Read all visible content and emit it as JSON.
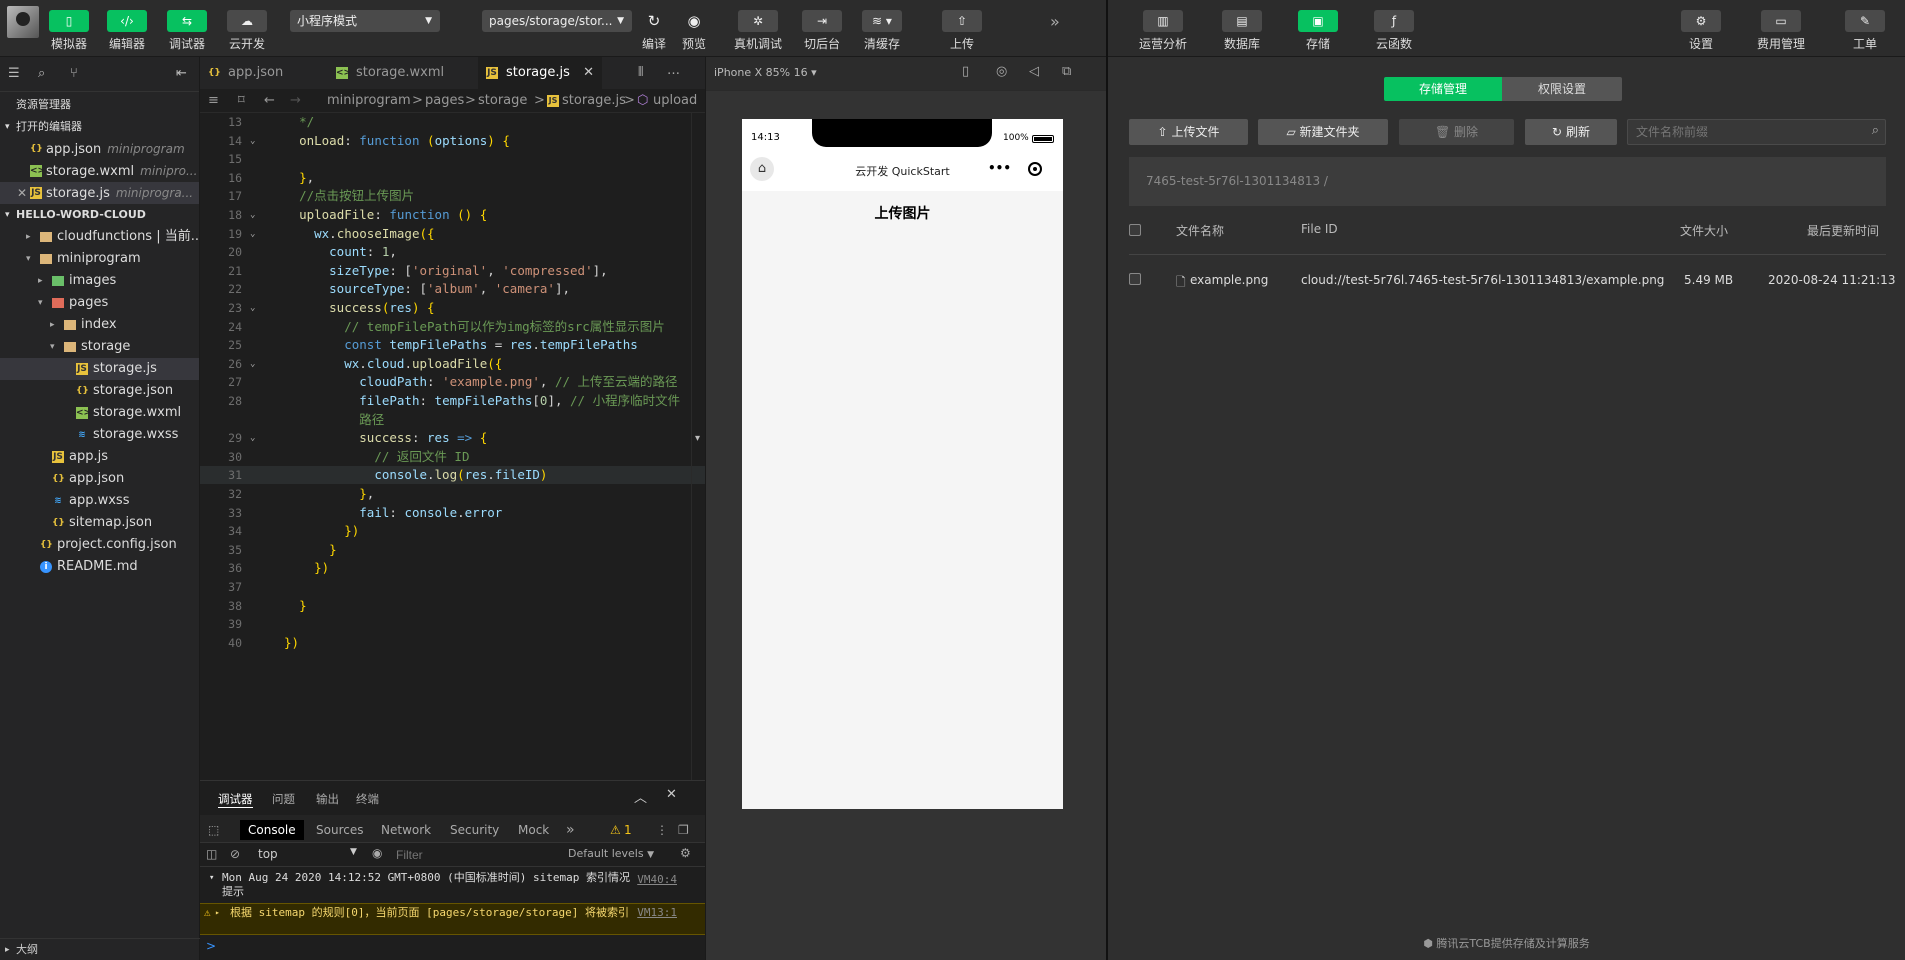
{
  "toolbar": {
    "buttons": [
      {
        "icon": "phone-icon",
        "label": "模拟器"
      },
      {
        "icon": "code-icon",
        "label": "编辑器"
      },
      {
        "icon": "debug-icon",
        "label": "调试器"
      },
      {
        "icon": "cloud-icon",
        "label": "云开发"
      }
    ],
    "mode_select": "小程序模式",
    "page_select": "pages/storage/stor...",
    "actions": [
      {
        "icon": "refresh-icon",
        "label": "编译"
      },
      {
        "icon": "eye-icon",
        "label": "预览"
      },
      {
        "icon": "bug-icon",
        "label": "真机调试"
      },
      {
        "icon": "switch-icon",
        "label": "切后台"
      },
      {
        "icon": "layers-icon",
        "label": "清缓存"
      },
      {
        "icon": "upload-icon",
        "label": "上传"
      }
    ],
    "more": "»"
  },
  "right_toolbar": {
    "left": [
      {
        "icon": "chart-icon",
        "label": "运营分析"
      },
      {
        "icon": "database-icon",
        "label": "数据库"
      },
      {
        "icon": "storage-icon",
        "label": "存储"
      },
      {
        "icon": "function-icon",
        "label": "云函数"
      }
    ],
    "right": [
      {
        "icon": "gear-icon",
        "label": "设置"
      },
      {
        "icon": "billing-icon",
        "label": "费用管理"
      },
      {
        "icon": "ticket-icon",
        "label": "工单"
      }
    ]
  },
  "explorer": {
    "title": "资源管理器",
    "open_editors": "打开的编辑器",
    "open_files": [
      {
        "name": "app.json",
        "sub": "miniprogram",
        "type": "json"
      },
      {
        "name": "storage.wxml",
        "sub": "minipro...",
        "type": "wx"
      },
      {
        "name": "storage.js",
        "sub": "miniprogra...",
        "type": "js"
      }
    ],
    "project": "HELLO-WORD-CLOUD",
    "tree": [
      {
        "name": "cloudfunctions | 当前...",
        "type": "fold",
        "depth": 1,
        "tw": "▸"
      },
      {
        "name": "miniprogram",
        "type": "fold",
        "depth": 1,
        "tw": "▾"
      },
      {
        "name": "images",
        "type": "foldi",
        "depth": 2,
        "tw": "▸"
      },
      {
        "name": "pages",
        "type": "foldr",
        "depth": 2,
        "tw": "▾"
      },
      {
        "name": "index",
        "type": "fold",
        "depth": 3,
        "tw": "▸"
      },
      {
        "name": "storage",
        "type": "fold",
        "depth": 3,
        "tw": "▾"
      },
      {
        "name": "storage.js",
        "type": "js",
        "depth": 4,
        "tw": ""
      },
      {
        "name": "storage.json",
        "type": "json",
        "depth": 4,
        "tw": ""
      },
      {
        "name": "storage.wxml",
        "type": "wx",
        "depth": 4,
        "tw": ""
      },
      {
        "name": "storage.wxss",
        "type": "ss",
        "depth": 4,
        "tw": ""
      },
      {
        "name": "app.js",
        "type": "js",
        "depth": 2,
        "tw": ""
      },
      {
        "name": "app.json",
        "type": "json",
        "depth": 2,
        "tw": ""
      },
      {
        "name": "app.wxss",
        "type": "ss",
        "depth": 2,
        "tw": ""
      },
      {
        "name": "sitemap.json",
        "type": "json",
        "depth": 2,
        "tw": ""
      },
      {
        "name": "project.config.json",
        "type": "json",
        "depth": 1,
        "tw": ""
      },
      {
        "name": "README.md",
        "type": "info",
        "depth": 1,
        "tw": ""
      }
    ],
    "outline": "大纲"
  },
  "editor": {
    "tabs": [
      {
        "name": "app.json",
        "type": "json"
      },
      {
        "name": "storage.wxml",
        "type": "wx"
      },
      {
        "name": "storage.js",
        "type": "js"
      }
    ],
    "breadcrumb": [
      "miniprogram",
      "pages",
      "storage",
      "storage.js",
      "upload"
    ],
    "breadcrumb_sep": ">",
    "lines": [
      {
        "n": "13",
        "fold": "",
        "html": "  <span class='c'>*/</span>"
      },
      {
        "n": "14",
        "fold": "⌄",
        "html": "  <span class='f'>onLoad</span><span class='o'>: </span><span class='k'>function</span> <span class='y'>(</span><span class='p'>options</span><span class='y'>)</span> <span class='y'>{</span>"
      },
      {
        "n": "15",
        "fold": "",
        "html": ""
      },
      {
        "n": "16",
        "fold": "",
        "html": "  <span class='y'>}</span><span class='o'>,</span>"
      },
      {
        "n": "17",
        "fold": "",
        "html": "  <span class='c'>//点击按钮上传图片</span>"
      },
      {
        "n": "18",
        "fold": "⌄",
        "html": "  <span class='f'>uploadFile</span><span class='o'>: </span><span class='k'>function</span> <span class='y'>()</span> <span class='y'>{</span>"
      },
      {
        "n": "19",
        "fold": "⌄",
        "html": "    <span class='p'>wx</span><span class='o'>.</span><span class='f'>chooseImage</span><span class='y'>({</span>"
      },
      {
        "n": "20",
        "fold": "",
        "html": "      <span class='p'>count</span><span class='o'>: </span><span class='n'>1</span><span class='o'>,</span>"
      },
      {
        "n": "21",
        "fold": "",
        "html": "      <span class='p'>sizeType</span><span class='o'>: [</span><span class='s'>'original'</span><span class='o'>, </span><span class='s'>'compressed'</span><span class='o'>],</span>"
      },
      {
        "n": "22",
        "fold": "",
        "html": "      <span class='p'>sourceType</span><span class='o'>: [</span><span class='s'>'album'</span><span class='o'>, </span><span class='s'>'camera'</span><span class='o'>],</span>"
      },
      {
        "n": "23",
        "fold": "⌄",
        "html": "      <span class='f'>success</span><span class='y'>(</span><span class='p'>res</span><span class='y'>)</span> <span class='y'>{</span>"
      },
      {
        "n": "24",
        "fold": "",
        "html": "        <span class='c'>// tempFilePath可以作为img标签的src属性显示图片</span>"
      },
      {
        "n": "25",
        "fold": "",
        "html": "        <span class='k'>const</span> <span class='p'>tempFilePaths</span><span class='o'> = </span><span class='p'>res</span><span class='o'>.</span><span class='p'>tempFilePaths</span>"
      },
      {
        "n": "26",
        "fold": "⌄",
        "html": "        <span class='p'>wx</span><span class='o'>.</span><span class='p'>cloud</span><span class='o'>.</span><span class='f'>uploadFile</span><span class='y'>({</span>"
      },
      {
        "n": "27",
        "fold": "",
        "html": "          <span class='p'>cloudPath</span><span class='o'>: </span><span class='s'>'example.png'</span><span class='o'>, </span><span class='c'>// 上传至云端的路径</span>"
      },
      {
        "n": "28",
        "fold": "",
        "html": "          <span class='p'>filePath</span><span class='o'>: </span><span class='p'>tempFilePaths</span><span class='o'>[</span><span class='n'>0</span><span class='o'>], </span><span class='c'>// 小程序临时文件</span>"
      },
      {
        "n": "",
        "fold": "",
        "html": "          <span class='c'>路径</span>"
      },
      {
        "n": "29",
        "fold": "⌄",
        "html": "          <span class='f'>success</span><span class='o'>: </span><span class='p'>res</span> <span class='k'>=&gt;</span> <span class='y'>{</span>"
      },
      {
        "n": "30",
        "fold": "",
        "html": "            <span class='c'>// 返回文件 ID</span>"
      },
      {
        "n": "31",
        "fold": "",
        "html": "            <span class='p'>console</span><span class='o'>.</span><span class='f'>log</span><span class='y'>(</span><span class='p'>res</span><span class='o'>.</span><span class='p'>fileID</span><span class='y'>)</span>"
      },
      {
        "n": "32",
        "fold": "",
        "html": "          <span class='y'>}</span><span class='o'>,</span>"
      },
      {
        "n": "33",
        "fold": "",
        "html": "          <span class='p'>fail</span><span class='o'>: </span><span class='p'>console</span><span class='o'>.</span><span class='p'>error</span>"
      },
      {
        "n": "34",
        "fold": "",
        "html": "        <span class='y'>})</span>"
      },
      {
        "n": "35",
        "fold": "",
        "html": "      <span class='y'>}</span>"
      },
      {
        "n": "36",
        "fold": "",
        "html": "    <span class='y'>})</span>"
      },
      {
        "n": "37",
        "fold": "",
        "html": ""
      },
      {
        "n": "38",
        "fold": "",
        "html": "  <span class='y'>}</span>"
      },
      {
        "n": "39",
        "fold": "",
        "html": ""
      },
      {
        "n": "40",
        "fold": "",
        "html": "<span class='y'>})</span>"
      }
    ]
  },
  "devtools": {
    "tabs": [
      "调试器",
      "问题",
      "输出",
      "终端"
    ],
    "console_tabs": [
      "Console",
      "Sources",
      "Network",
      "Security",
      "Mock"
    ],
    "more": "»",
    "warning_count": "1",
    "context": "top",
    "filter_placeholder": "Filter",
    "levels": "Default levels",
    "messages": [
      {
        "text": "Mon Aug 24 2020 14:12:52 GMT+0800 (中国标准时间) sitemap 索引情况提示",
        "link": "VM40:4"
      },
      {
        "text": "根据 sitemap 的规则[0]，当前页面 [pages/storage/storage] 将被索引",
        "link": "VM13:1"
      }
    ],
    "prompt": ">"
  },
  "simulator": {
    "device": "iPhone X 85% 16 ▾",
    "time": "14:13",
    "battery": "100%",
    "app_title": "云开发 QuickStart",
    "page_heading": "上传图片",
    "menu_dots": "•••"
  },
  "storage": {
    "tabs": [
      "存储管理",
      "权限设置"
    ],
    "buttons": {
      "upload": "上传文件",
      "new_folder": "新建文件夹",
      "delete": "删除",
      "refresh": "刷新"
    },
    "search_placeholder": "文件名称前缀",
    "path": "7465-test-5r76l-1301134813 /",
    "columns": [
      "文件名称",
      "File ID",
      "文件大小",
      "最后更新时间"
    ],
    "rows": [
      {
        "name": "example.png",
        "file_id": "cloud://test-5r76l.7465-test-5r76l-1301134813/example.png",
        "size": "5.49 MB",
        "updated": "2020-08-24 11:21:13"
      }
    ],
    "footer": "腾讯云TCB提供存储及计算服务"
  }
}
